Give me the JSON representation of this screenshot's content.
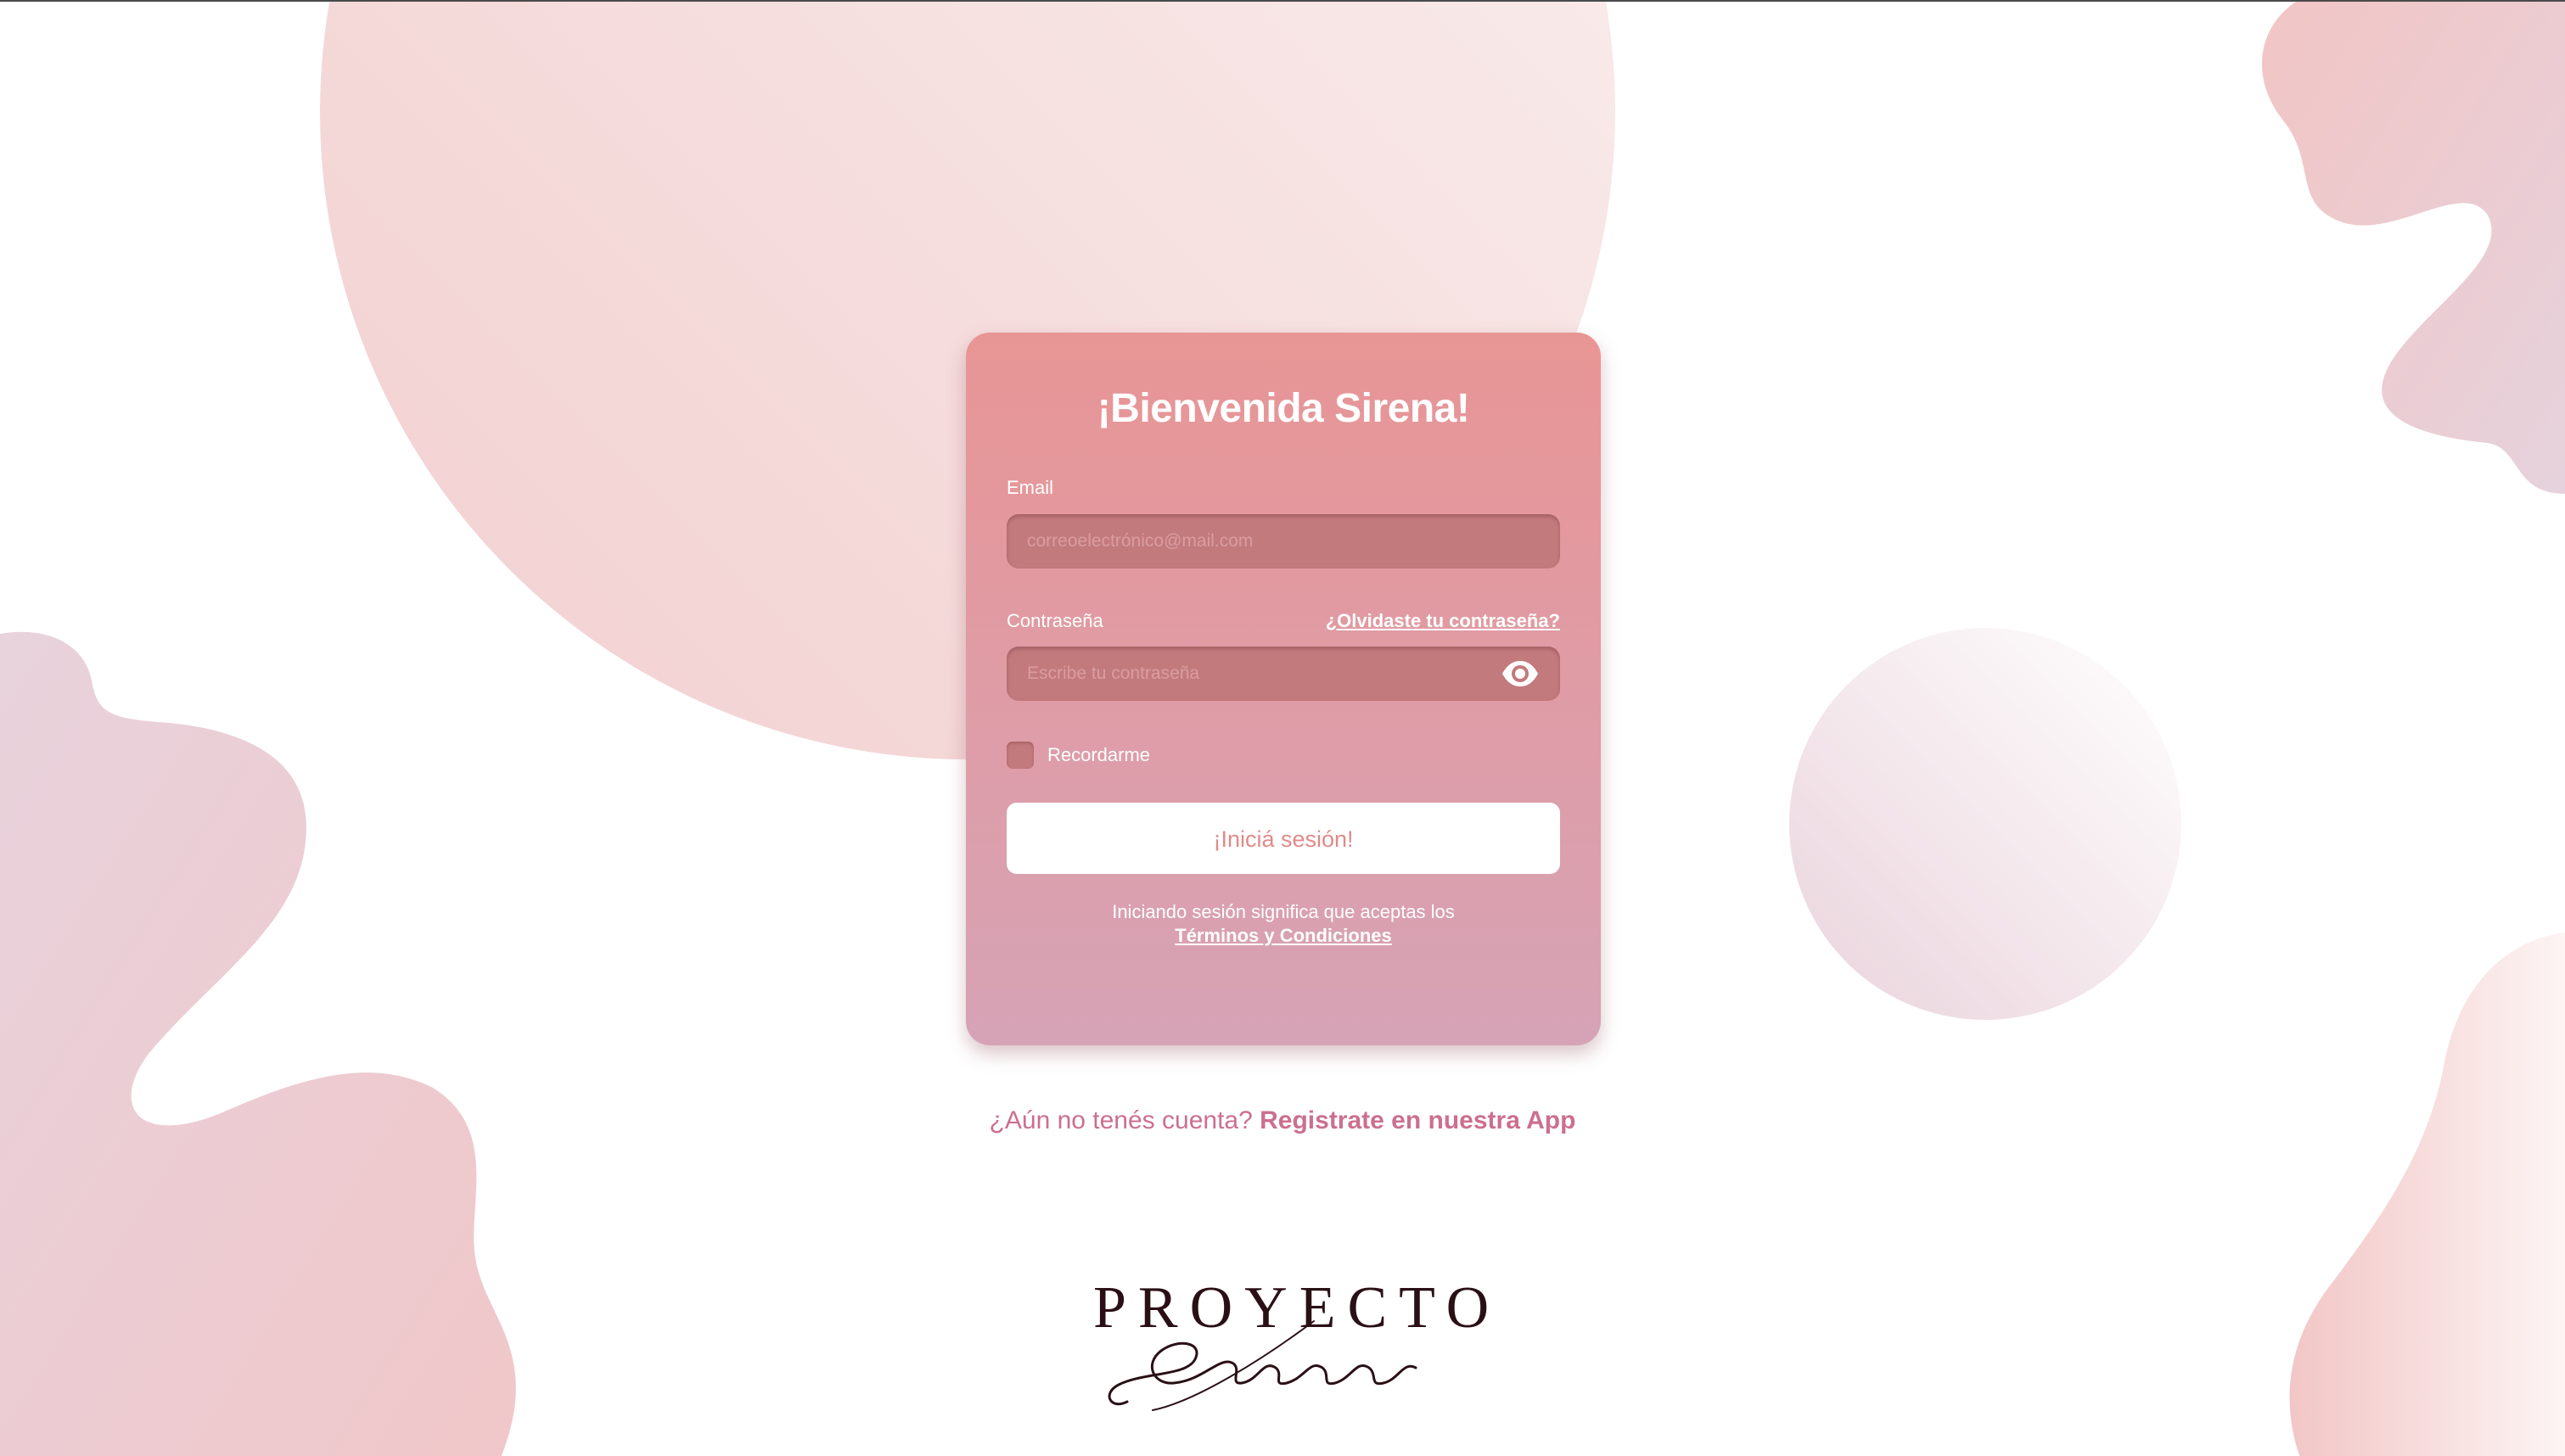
{
  "colors": {
    "card_top": "#e89595",
    "card_bottom": "#d6a3b6",
    "field_bg": "#c37a7d",
    "button_text": "#e08a8a",
    "signup_text": "#cc6f8e",
    "logo_text": "#2a1016"
  },
  "login": {
    "title": "¡Bienvenida Sirena!",
    "email_label": "Email",
    "email_placeholder": "correoelectrónico@mail.com",
    "password_label": "Contraseña",
    "forgot_link": "¿Olvidaste tu contraseña?",
    "password_placeholder": "Escribe tu contraseña",
    "show_password_icon": "eye-icon",
    "remember_label": "Recordarme",
    "remember_checked": false,
    "submit_label": "¡Iniciá sesión!",
    "terms_text": "Iniciando sesión significa que aceptas los",
    "terms_link": "Términos y Condiciones"
  },
  "signup": {
    "prompt": "¿Aún no tenés cuenta?",
    "link": "Registrate en nuestra App"
  },
  "logo": {
    "word": "PROYECTO",
    "script": "Sirenas"
  }
}
